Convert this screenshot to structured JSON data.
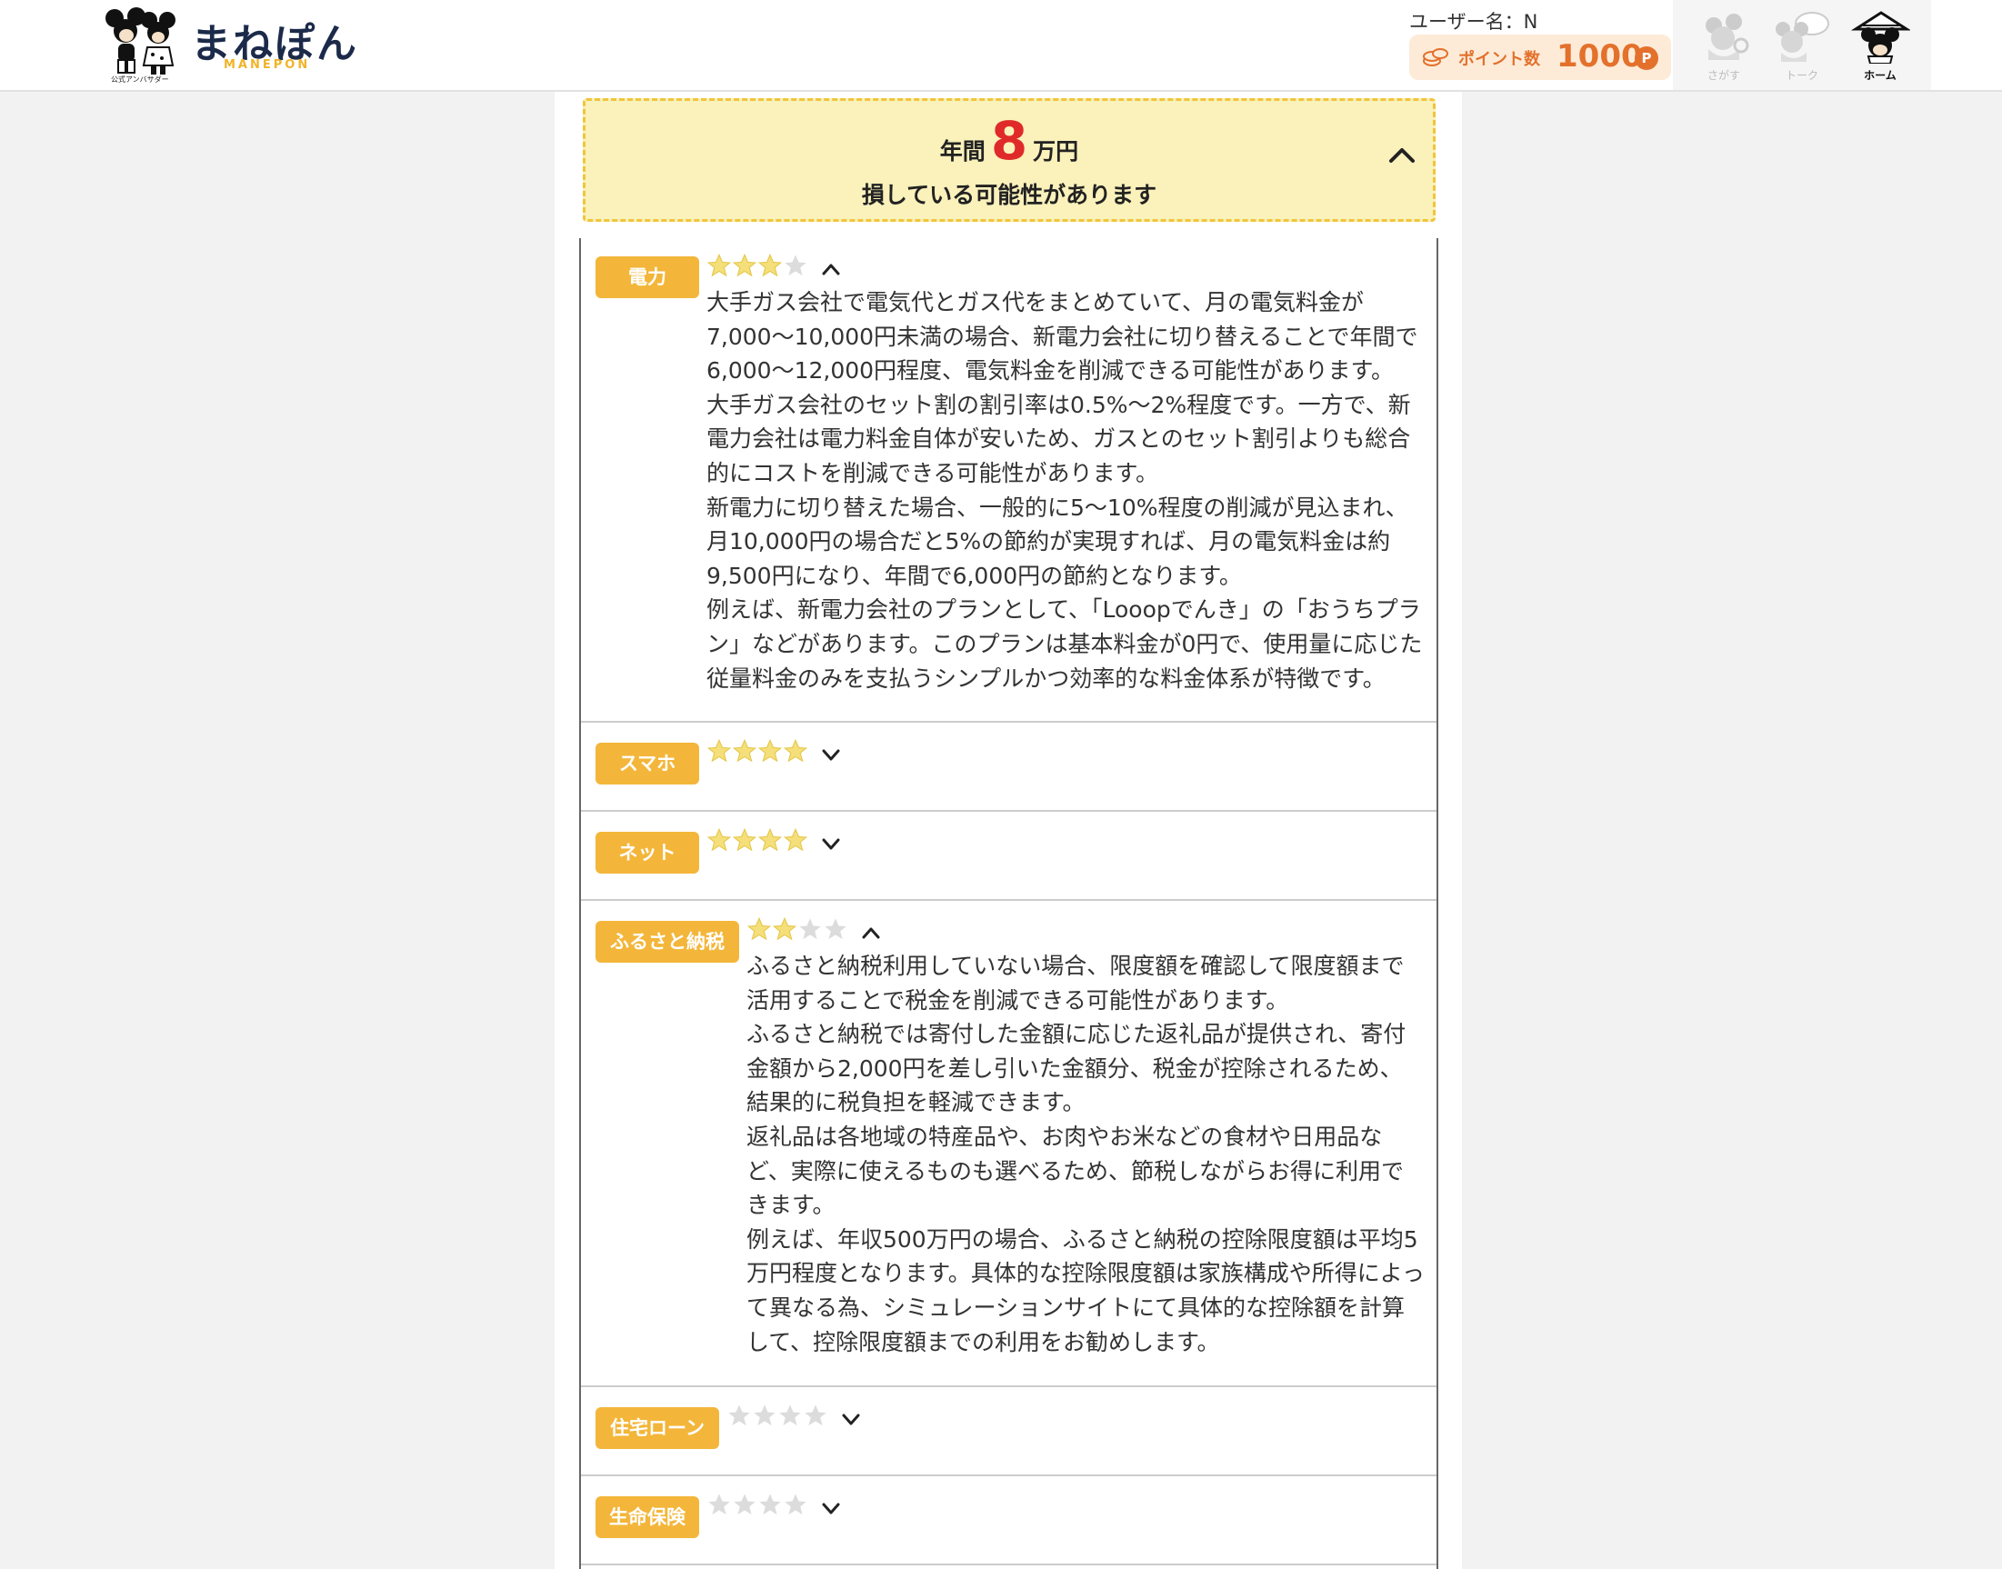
{
  "header": {
    "logo_text": "まねぽん",
    "logo_en": "MANEPON",
    "logo_sub": "公式アンバサダー",
    "user_name": "ユーザー名：N",
    "points_label": "ポイント数",
    "points_value": "1000",
    "points_unit": "P",
    "nav": [
      {
        "label": "さがす",
        "icon": "mickey-search-icon",
        "active": false
      },
      {
        "label": "トーク",
        "icon": "mickey-talk-icon",
        "active": false
      },
      {
        "label": "ホーム",
        "icon": "mickey-home-icon",
        "active": true
      }
    ]
  },
  "banner": {
    "prefix": "年間",
    "amount": "8",
    "suffix": "万円",
    "line2": "損している可能性があります"
  },
  "categories": [
    {
      "label": "電力",
      "rating": 3,
      "max_rating": 4,
      "expanded": true,
      "paragraphs": [
        "大手ガス会社で電気代とガス代をまとめていて、月の電気料金が7,000〜10,000円未満の場合、新電力会社に切り替えることで年間で6,000〜12,000円程度、電気料金を削減できる可能性があります。",
        "大手ガス会社のセット割の割引率は0.5%〜2%程度です。一方で、新電力会社は電力料金自体が安いため、ガスとのセット割引よりも総合的にコストを削減できる可能性があります。",
        "新電力に切り替えた場合、一般的に5〜10%程度の削減が見込まれ、月10,000円の場合だと5%の節約が実現すれば、月の電気料金は約9,500円になり、年間で6,000円の節約となります。",
        "例えば、新電力会社のプランとして、「Looopでんき」の「おうちプラン」などがあります。このプランは基本料金が0円で、使用量に応じた従量料金のみを支払うシンプルかつ効率的な料金体系が特徴です。"
      ]
    },
    {
      "label": "スマホ",
      "rating": 4,
      "max_rating": 4,
      "expanded": false,
      "paragraphs": []
    },
    {
      "label": "ネット",
      "rating": 4,
      "max_rating": 4,
      "expanded": false,
      "paragraphs": []
    },
    {
      "label": "ふるさと納税",
      "rating": 2,
      "max_rating": 4,
      "expanded": true,
      "paragraphs": [
        "ふるさと納税利用していない場合、限度額を確認して限度額まで活用することで税金を削減できる可能性があります。",
        "ふるさと納税では寄付した金額に応じた返礼品が提供され、寄付金額から2,000円を差し引いた金額分、税金が控除されるため、結果的に税負担を軽減できます。",
        "返礼品は各地域の特産品や、お肉やお米などの食材や日用品など、実際に使えるものも選べるため、節税しながらお得に利用できます。",
        "例えば、年収500万円の場合、ふるさと納税の控除限度額は平均5万円程度となります。具体的な控除限度額は家族構成や所得によって異なる為、シミュレーションサイトにて具体的な控除額を計算して、控除限度額までの利用をお勧めします。"
      ]
    },
    {
      "label": "住宅ローン",
      "rating": 0,
      "max_rating": 4,
      "expanded": false,
      "paragraphs": []
    },
    {
      "label": "生命保険",
      "rating": 0,
      "max_rating": 4,
      "expanded": false,
      "paragraphs": []
    }
  ],
  "colors": {
    "accent": "#f3b63a",
    "banner_bg": "#faf1bb",
    "banner_border": "#f0c53a",
    "amount_red": "#e02a2a",
    "points_orange": "#e3712c",
    "star_filled": "#f5df7a",
    "star_empty": "#d8d8d8"
  }
}
